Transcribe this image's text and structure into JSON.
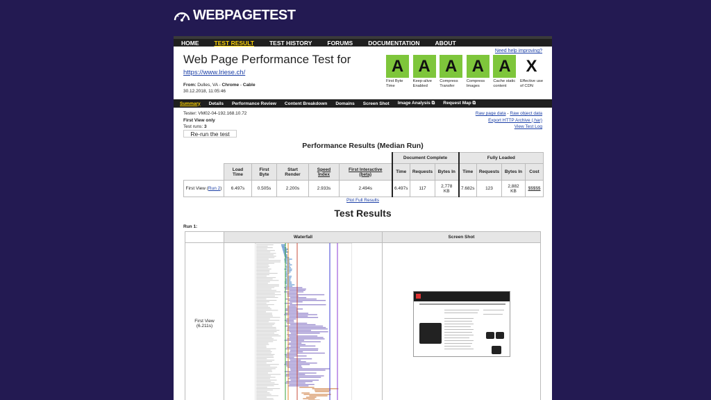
{
  "brand": {
    "logo_text": "WEBPAGETEST"
  },
  "main_nav": [
    {
      "label": "HOME",
      "active": false
    },
    {
      "label": "TEST RESULT",
      "active": true
    },
    {
      "label": "TEST HISTORY",
      "active": false
    },
    {
      "label": "FORUMS",
      "active": false
    },
    {
      "label": "DOCUMENTATION",
      "active": false
    },
    {
      "label": "ABOUT",
      "active": false
    }
  ],
  "header": {
    "help_link": "Need help improving?",
    "title": "Web Page Performance Test for",
    "url": "https://www.lriese.ch/",
    "from_label": "From:",
    "location": "Dulles, VA",
    "browser": "Chrome",
    "connection": "Cable",
    "date": "30.12.2018, 11:05:46"
  },
  "grades": [
    {
      "grade": "A",
      "label": "First Byte Time"
    },
    {
      "grade": "A",
      "label": "Keep-alive Enabled"
    },
    {
      "grade": "A",
      "label": "Compress Transfer"
    },
    {
      "grade": "A",
      "label": "Compress Images"
    },
    {
      "grade": "A",
      "label": "Cache static content"
    },
    {
      "grade": "X",
      "label": "Effective use of CDN"
    }
  ],
  "sub_nav": [
    {
      "label": "Summary",
      "active": true
    },
    {
      "label": "Details"
    },
    {
      "label": "Performance Review"
    },
    {
      "label": "Content Breakdown"
    },
    {
      "label": "Domains"
    },
    {
      "label": "Screen Shot"
    },
    {
      "label": "Image Analysis",
      "external": true
    },
    {
      "label": "Request Map",
      "external": true
    }
  ],
  "tester": {
    "tester_line": "Tester: VM02-04-192.168.10.72",
    "view": "First View only",
    "runs_label": "Test runs:",
    "runs_value": "3",
    "rerun_button": "Re-run the test"
  },
  "raw_links": {
    "raw_page": "Raw page data",
    "separator": "-",
    "raw_object": "Raw object data",
    "export_har": "Export HTTP Archive (.har)",
    "test_log": "View Test Log"
  },
  "performance": {
    "title": "Performance Results (Median Run)",
    "group_doc": "Document Complete",
    "group_full": "Fully Loaded",
    "headers": {
      "load_time": [
        "Load",
        "Time"
      ],
      "first_byte": [
        "First",
        "Byte"
      ],
      "start_render": [
        "Start",
        "Render"
      ],
      "speed_index": [
        "Speed",
        "Index"
      ],
      "first_interactive": [
        "First Interactive",
        "(beta)"
      ],
      "doc_time": "Time",
      "doc_requests": "Requests",
      "doc_bytes": "Bytes In",
      "full_time": "Time",
      "full_requests": "Requests",
      "full_bytes": "Bytes In",
      "cost": "Cost"
    },
    "row": {
      "label": "First View (",
      "run_link": "Run 2",
      "label_end": ")",
      "load_time": "6.497s",
      "first_byte": "0.505s",
      "start_render": "2.200s",
      "speed_index": "2.933s",
      "first_interactive": "2.494s",
      "doc_time": "6.497s",
      "doc_requests": "117",
      "doc_bytes": [
        "2,778",
        "KB"
      ],
      "full_time": "7.682s",
      "full_requests": "123",
      "full_bytes": [
        "2,882",
        "KB"
      ],
      "cost": "$$$$$"
    },
    "plot_link": "Plot Full Results"
  },
  "test_results": {
    "title": "Test Results",
    "run_label": "Run 1:",
    "col_waterfall": "Waterfall",
    "col_screenshot": "Screen Shot",
    "row_label": "First View",
    "row_time": "(6.211s)"
  },
  "colors": {
    "page_bg": "#231a52",
    "grade_green": "#7ec63b",
    "nav_bg": "#1f1f1f",
    "nav_active": "#ffd400",
    "link": "#1a3ea6"
  }
}
